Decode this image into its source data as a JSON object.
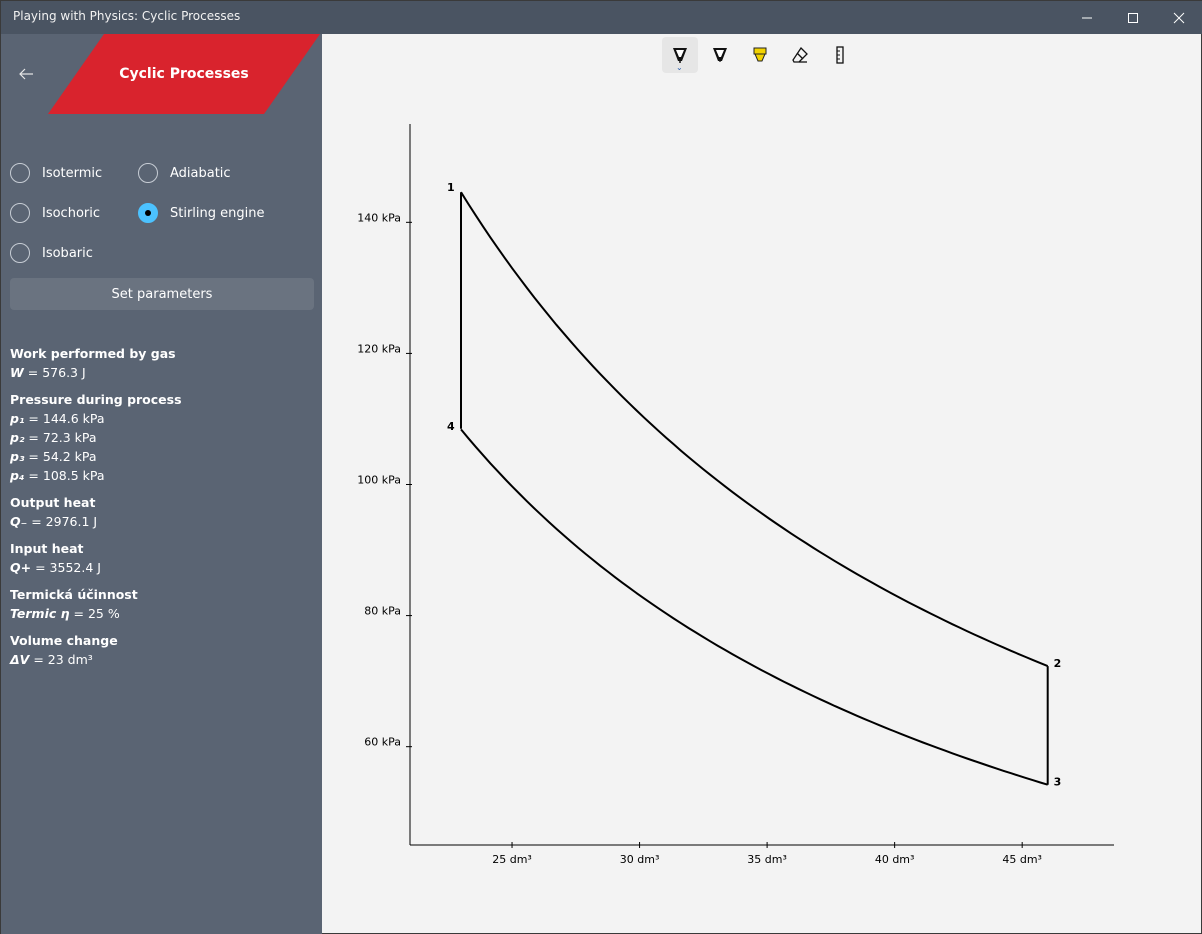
{
  "window": {
    "title": "Playing with Physics: Cyclic Processes"
  },
  "sidebar": {
    "banner_title": "Cyclic Processes",
    "radios": [
      {
        "label": "Isotermic",
        "checked": false
      },
      {
        "label": "Adiabatic",
        "checked": false
      },
      {
        "label": "Isochoric",
        "checked": false
      },
      {
        "label": "Stirling engine",
        "checked": true
      },
      {
        "label": "Isobaric",
        "checked": false
      }
    ],
    "set_parameters_label": "Set parameters",
    "results": {
      "work": {
        "heading": "Work performed by gas",
        "symbol": "W",
        "value": "= 576.3 J"
      },
      "pressure": {
        "heading": "Pressure during process",
        "items": [
          {
            "symbol": "p₁",
            "value": "= 144.6 kPa"
          },
          {
            "symbol": "p₂",
            "value": "= 72.3 kPa"
          },
          {
            "symbol": "p₃",
            "value": "= 54.2 kPa"
          },
          {
            "symbol": "p₄",
            "value": "= 108.5 kPa"
          }
        ]
      },
      "output_heat": {
        "heading": "Output heat",
        "symbol": "Q₋",
        "value": "= 2976.1 J"
      },
      "input_heat": {
        "heading": "Input heat",
        "symbol": "Q+",
        "value": "= 3552.4 J"
      },
      "efficiency": {
        "heading": "Termická účinnost",
        "symbol": "Termic η",
        "value": "= 25 %"
      },
      "volume": {
        "heading": "Volume change",
        "symbol": "ΔV",
        "value": "= 23 dm³"
      }
    }
  },
  "toolbar": {
    "tools": [
      {
        "name": "ballpoint-pen-icon",
        "active": true
      },
      {
        "name": "pencil-icon",
        "active": false
      },
      {
        "name": "highlighter-icon",
        "active": false
      },
      {
        "name": "eraser-icon",
        "active": false
      },
      {
        "name": "ruler-icon",
        "active": false
      }
    ]
  },
  "chart_data": {
    "type": "line",
    "title": "",
    "xlabel": "",
    "ylabel": "",
    "x_ticks": [
      "25 dm³",
      "30 dm³",
      "35 dm³",
      "40 dm³",
      "45 dm³"
    ],
    "x_tick_values": [
      25,
      30,
      35,
      40,
      45
    ],
    "y_ticks": [
      "60 kPa",
      "80 kPa",
      "100 kPa",
      "120 kPa",
      "140 kPa"
    ],
    "y_tick_values": [
      60,
      80,
      100,
      120,
      140
    ],
    "xlim": [
      21,
      48.6
    ],
    "ylim": [
      45,
      155
    ],
    "grid": false,
    "points": [
      {
        "label": "1",
        "x": 23,
        "y": 144.6
      },
      {
        "label": "2",
        "x": 46,
        "y": 72.3
      },
      {
        "label": "3",
        "x": 46,
        "y": 54.2
      },
      {
        "label": "4",
        "x": 23,
        "y": 108.5
      }
    ],
    "series": [
      {
        "segment": "1-2",
        "process": "isotherm",
        "x": [
          23,
          46
        ],
        "y": [
          144.6,
          72.3
        ]
      },
      {
        "segment": "2-3",
        "process": "isochoric",
        "x": [
          46,
          46
        ],
        "y": [
          72.3,
          54.2
        ]
      },
      {
        "segment": "3-4",
        "process": "isotherm",
        "x": [
          46,
          23
        ],
        "y": [
          54.2,
          108.5
        ]
      },
      {
        "segment": "4-1",
        "process": "isochoric",
        "x": [
          23,
          23
        ],
        "y": [
          108.5,
          144.6
        ]
      }
    ]
  }
}
